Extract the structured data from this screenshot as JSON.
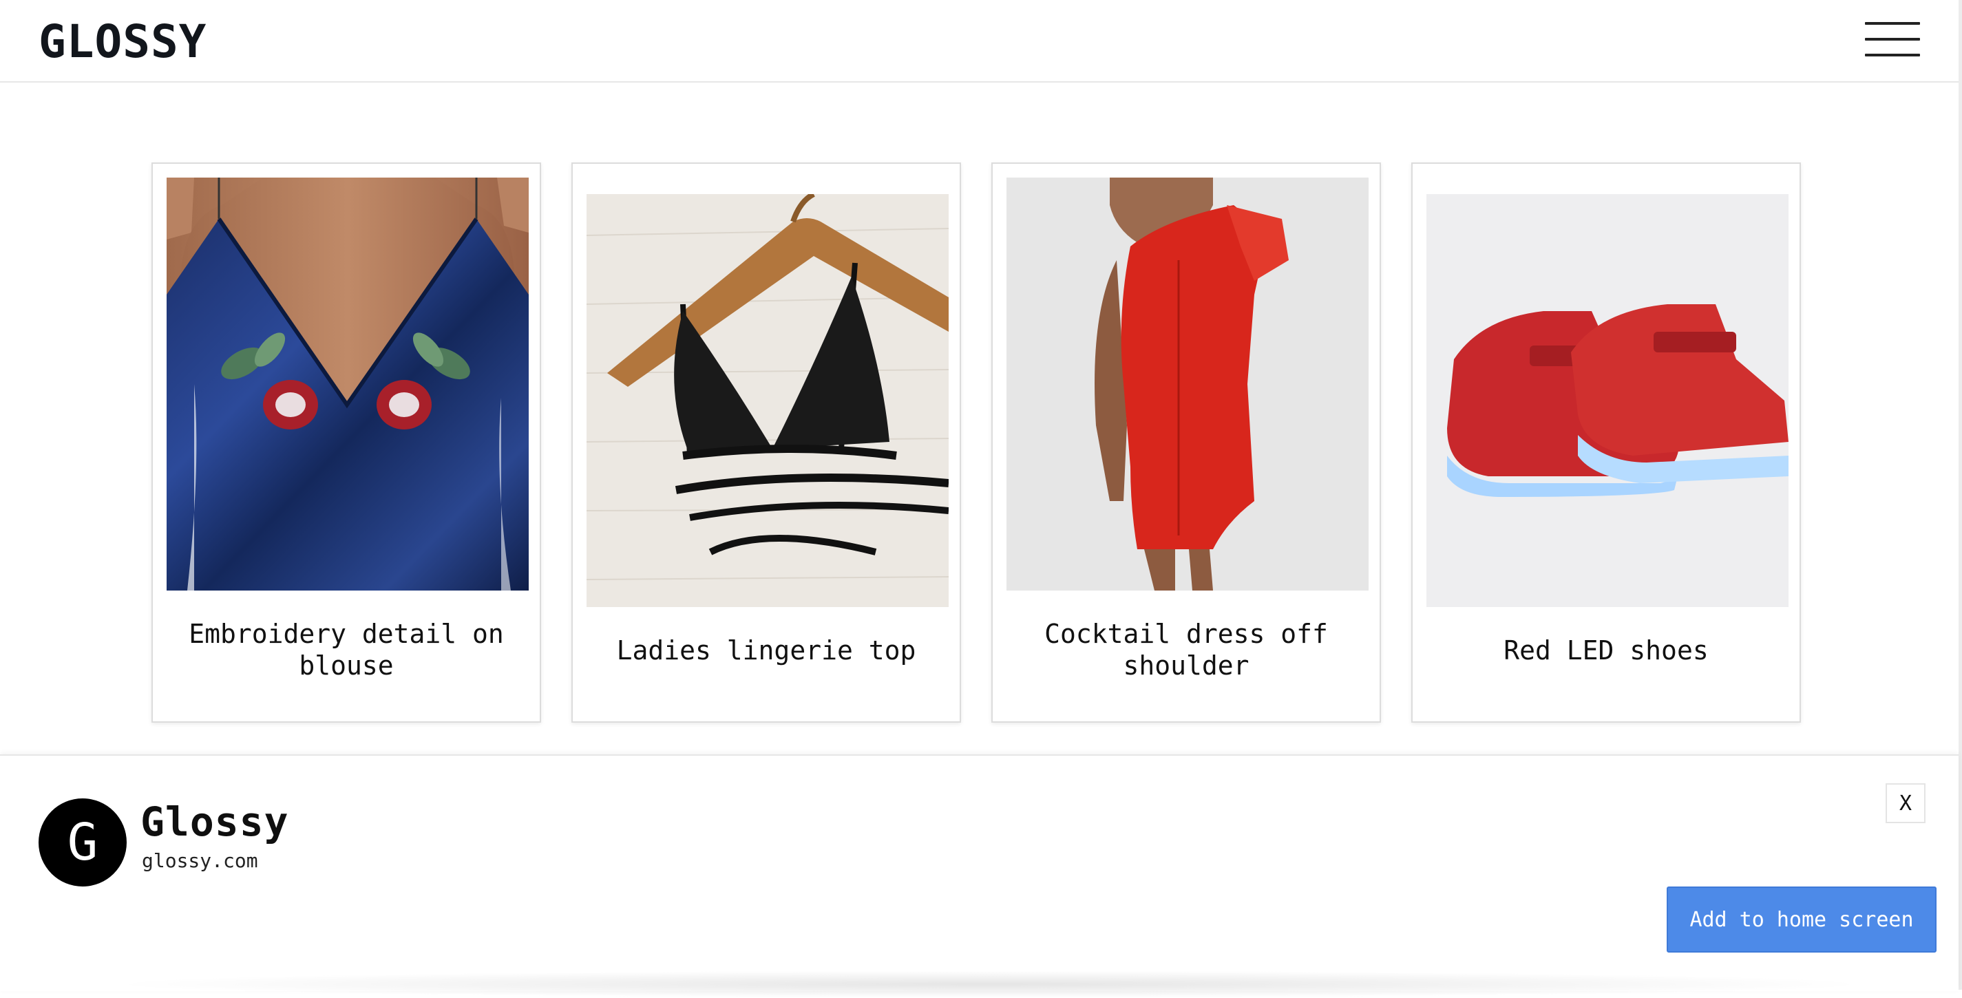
{
  "header": {
    "brand": "GLOSSY",
    "menu_icon": "hamburger-menu-icon"
  },
  "products": [
    {
      "title": "Embroidery detail on blouse",
      "image": "blue-satin-blouse-photo"
    },
    {
      "title": "Ladies lingerie top",
      "image": "black-lace-bralette-photo"
    },
    {
      "title": "Cocktail dress off shoulder",
      "image": "red-dress-photo"
    },
    {
      "title": "Red LED shoes",
      "image": "red-led-sneakers-photo"
    }
  ],
  "install_banner": {
    "icon_letter": "G",
    "app_name": "Glossy",
    "app_url": "glossy.com",
    "close_label": "X",
    "add_label": "Add to home screen"
  },
  "colors": {
    "accent": "#4d8ae8",
    "brand_text": "#12161c"
  }
}
